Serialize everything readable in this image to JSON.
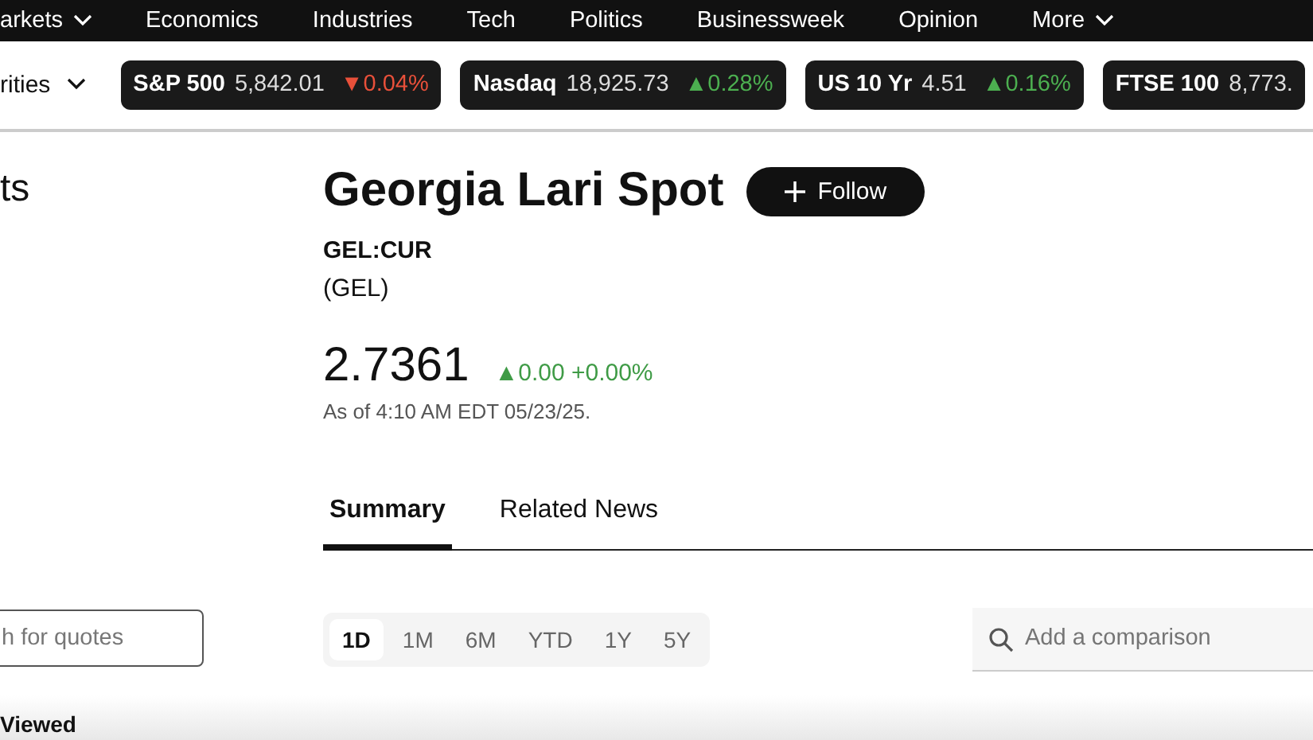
{
  "nav": {
    "items": [
      {
        "label": "arkets",
        "dropdown": true
      },
      {
        "label": "Economics",
        "dropdown": false
      },
      {
        "label": "Industries",
        "dropdown": false
      },
      {
        "label": "Tech",
        "dropdown": false
      },
      {
        "label": "Politics",
        "dropdown": false
      },
      {
        "label": "Businessweek",
        "dropdown": false
      },
      {
        "label": "Opinion",
        "dropdown": false
      },
      {
        "label": "More",
        "dropdown": true
      }
    ]
  },
  "ticker_bar": {
    "menu_label": "rities",
    "tickers": [
      {
        "name": "S&P 500",
        "value": "5,842.01",
        "change": "▼0.04%",
        "color": "#e8503a"
      },
      {
        "name": "Nasdaq",
        "value": "18,925.73",
        "change": "▲0.28%",
        "color": "#4caf50"
      },
      {
        "name": "US 10 Yr",
        "value": "4.51",
        "change": "▲0.16%",
        "color": "#4caf50"
      },
      {
        "name": "FTSE 100",
        "value": "8,773."
      }
    ]
  },
  "sidebar": {
    "heading": "ts",
    "search": {
      "placeholder": "h for quotes"
    },
    "section_title": "Viewed"
  },
  "quote": {
    "title": "Georgia Lari Spot",
    "follow_label": "Follow",
    "ticker": "GEL:CUR",
    "currency": "(GEL)",
    "price": "2.7361",
    "change": "▲0.00 +0.00%",
    "color": "#3f9b46",
    "as_of": "As of 4:10 AM EDT 05/23/25."
  },
  "tabs": [
    {
      "label": "Summary",
      "selected": true
    },
    {
      "label": "Related News",
      "selected": false
    }
  ],
  "ranges": [
    {
      "label": "1D",
      "selected": true
    },
    {
      "label": "1M",
      "selected": false
    },
    {
      "label": "6M",
      "selected": false
    },
    {
      "label": "YTD",
      "selected": false
    },
    {
      "label": "1Y",
      "selected": false
    },
    {
      "label": "5Y",
      "selected": false
    }
  ],
  "comparison": {
    "placeholder": "Add a comparison"
  }
}
